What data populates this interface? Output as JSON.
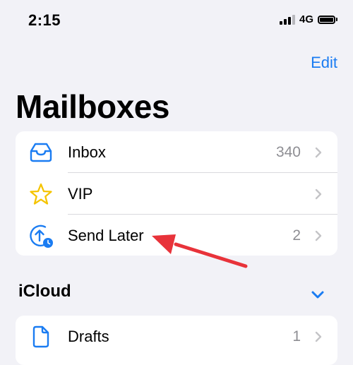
{
  "status_bar": {
    "time": "2:15",
    "network": "4G",
    "signal_bars_active": 3,
    "signal_bars_total": 4,
    "battery_icon": "battery-full-icon"
  },
  "header": {
    "edit_label": "Edit",
    "title": "Mailboxes"
  },
  "mailboxes": [
    {
      "label": "Inbox",
      "count": "340",
      "icon": "inbox-tray-icon"
    },
    {
      "label": "VIP",
      "count": "",
      "icon": "star-icon"
    },
    {
      "label": "Send Later",
      "count": "2",
      "icon": "send-later-clock-icon"
    }
  ],
  "icloud": {
    "header": "iCloud",
    "toggle_icon": "chevron-down-icon",
    "items": [
      {
        "label": "Drafts",
        "count": "1",
        "icon": "document-icon"
      }
    ]
  },
  "annotation": {
    "icon": "red-arrow-icon",
    "color": "#e8333a"
  },
  "colors": {
    "accent": "#1a7cf2",
    "vip_star": "#f5c400",
    "background": "#f2f2f7"
  }
}
